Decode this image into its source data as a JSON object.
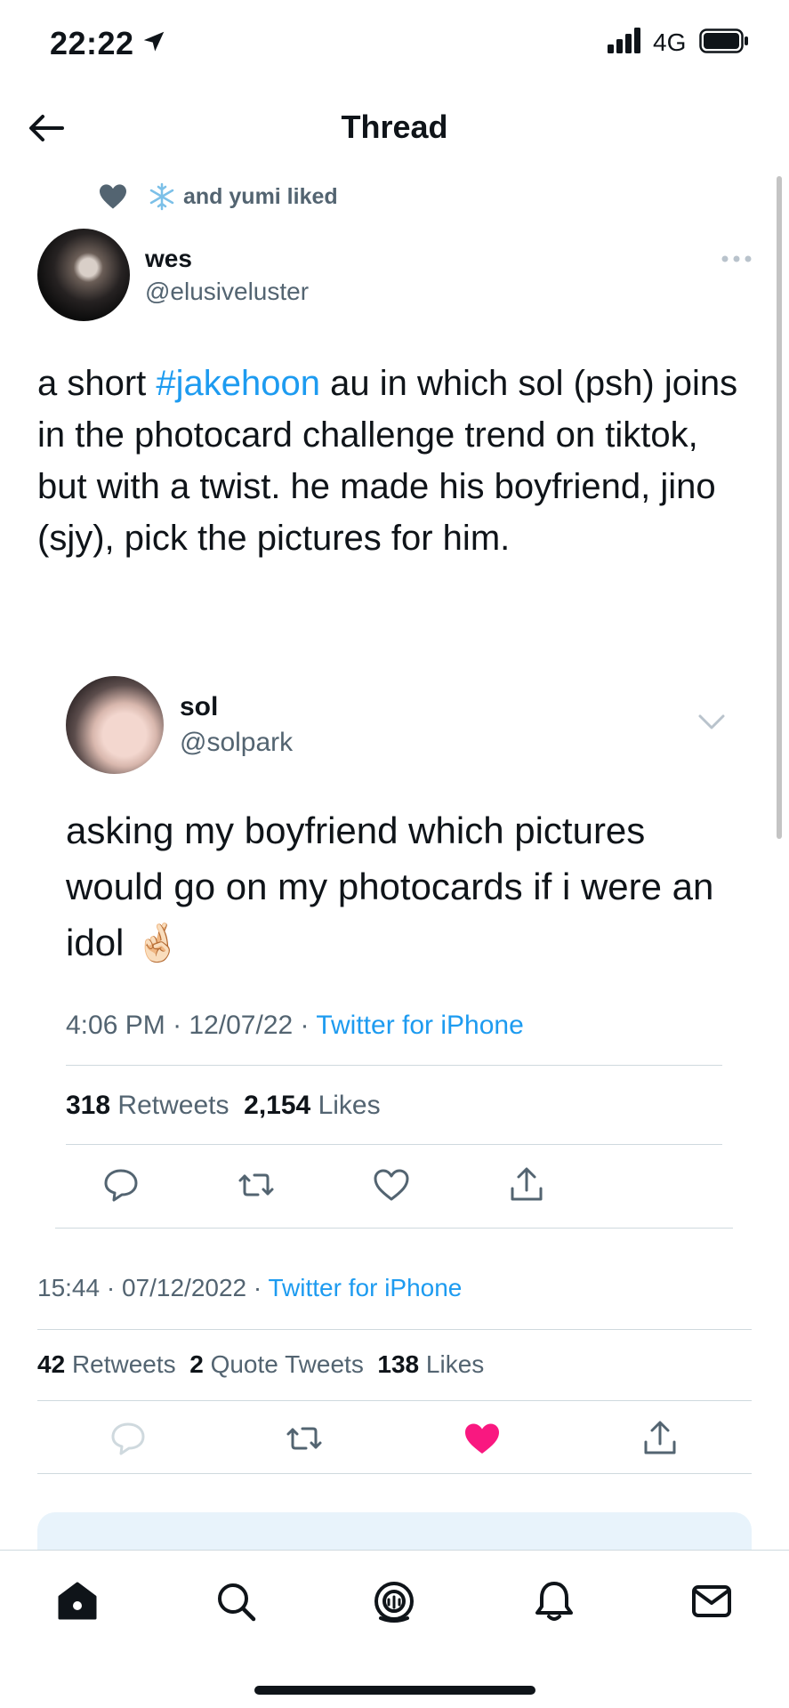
{
  "status_bar": {
    "time": "22:22",
    "network": "4G"
  },
  "header": {
    "title": "Thread"
  },
  "social_context": {
    "text": "and yumi liked"
  },
  "tweet": {
    "author_name": "wes",
    "author_handle": "@elusiveluster",
    "text_before": "a short ",
    "hashtag": "#jakehoon",
    "text_after": " au in which sol (psh) joins in the photocard challenge trend on tiktok, but with a twist. he made his boyfriend, jino (sjy), pick the pictures for him.",
    "time": "15:44",
    "date": "07/12/2022",
    "source": "Twitter for iPhone",
    "retweets": "42",
    "retweets_label": "Retweets",
    "quotes": "2",
    "quotes_label": "Quote Tweets",
    "likes": "138",
    "likes_label": "Likes",
    "liked": true
  },
  "quoted_tweet": {
    "author_name": "sol",
    "author_handle": "@solpark",
    "text": "asking my boyfriend which pictures would go on my photocards if i were an idol 🤞🏻",
    "time": "4:06 PM",
    "date": "12/07/22",
    "source": "Twitter for iPhone",
    "retweets": "318",
    "retweets_label": "Retweets",
    "likes": "2,154",
    "likes_label": "Likes"
  },
  "icons": {
    "back": "arrow-left-icon",
    "like_active_color": "#f91880",
    "link_color": "#1d9bf0",
    "muted_text": "#536471"
  }
}
